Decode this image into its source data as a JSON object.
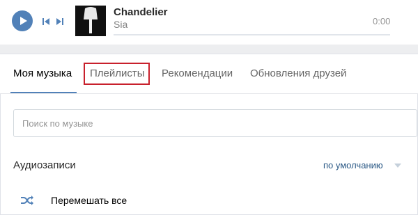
{
  "player": {
    "track_title": "Chandelier",
    "track_artist": "Sia",
    "time": "0:00",
    "progress": 0,
    "icons": {
      "play": "play-icon",
      "prev": "previous-track-icon",
      "next": "next-track-icon"
    },
    "accent_color": "#5181b8"
  },
  "tabs": [
    {
      "label": "Моя музыка",
      "active": true
    },
    {
      "label": "Плейлисты",
      "active": false,
      "highlighted": true
    },
    {
      "label": "Рекомендации",
      "active": false
    },
    {
      "label": "Обновления друзей",
      "active": false
    }
  ],
  "search": {
    "placeholder": "Поиск по музыке",
    "value": ""
  },
  "section": {
    "title": "Аудиозаписи",
    "sort_label": "по умолчанию"
  },
  "shuffle": {
    "label": "Перемешать все",
    "icon": "shuffle-icon"
  },
  "colors": {
    "highlight_box": "#c8202c",
    "link": "#2a5885"
  }
}
